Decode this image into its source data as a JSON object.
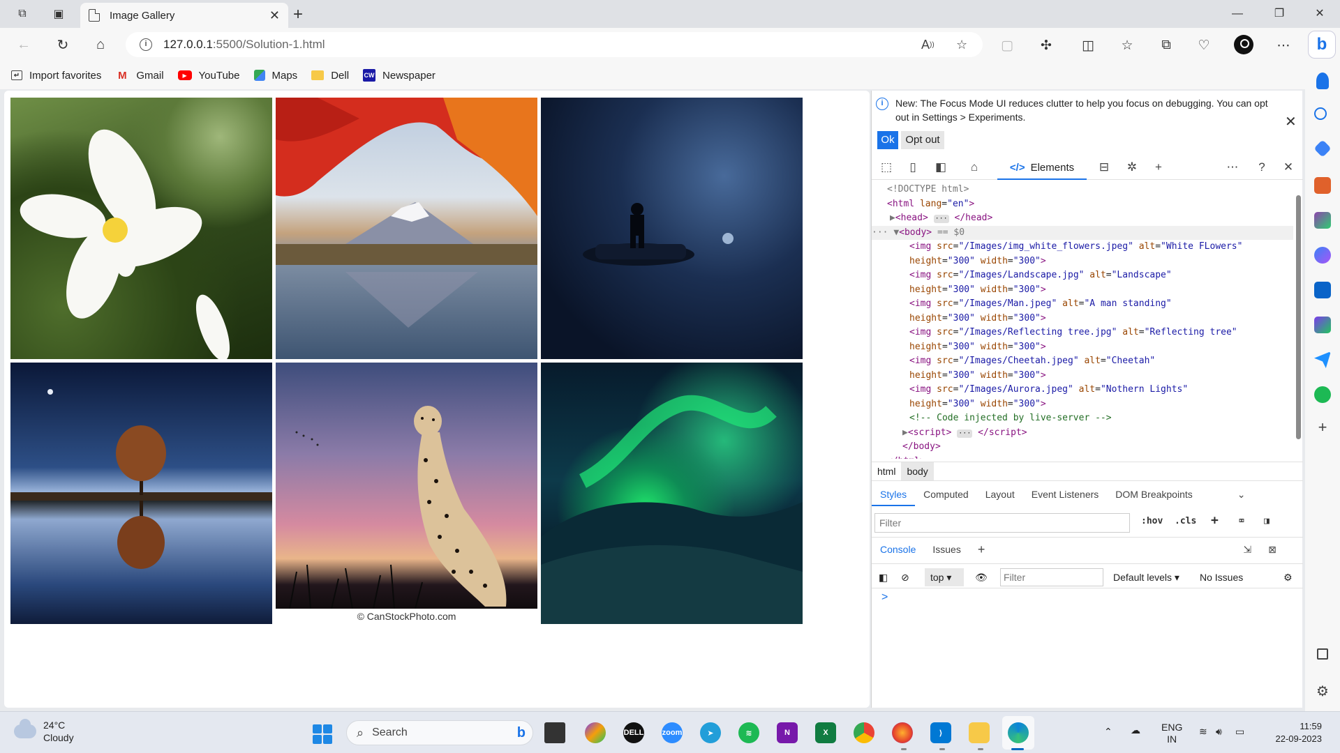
{
  "browser": {
    "tab_title": "Image Gallery",
    "url_host": "127.0.0.1",
    "url_rest": ":5500/Solution-1.html",
    "favorites": [
      {
        "label": "Import favorites",
        "icon": "import-icon"
      },
      {
        "label": "Gmail",
        "icon": "gmail-icon"
      },
      {
        "label": "YouTube",
        "icon": "youtube-icon"
      },
      {
        "label": "Maps",
        "icon": "maps-icon"
      },
      {
        "label": "Dell",
        "icon": "folder-icon"
      },
      {
        "label": "Newspaper",
        "icon": "cw-icon"
      }
    ]
  },
  "gallery": {
    "images": [
      {
        "alt": "White FLowers"
      },
      {
        "alt": "Landscape"
      },
      {
        "alt": "A man standing"
      },
      {
        "alt": "Reflecting tree"
      },
      {
        "alt": "Cheetah",
        "caption": "© CanStockPhoto.com"
      },
      {
        "alt": "Nothern Lights"
      }
    ]
  },
  "devtools": {
    "info_message": "New: The Focus Mode UI reduces clutter to help you focus on debugging. You can opt out in Settings > Experiments.",
    "ok_label": "Ok",
    "opt_out_label": "Opt out",
    "elements_tab": "Elements",
    "dom": {
      "doctype": "<!DOCTYPE html>",
      "html_lang": "en",
      "body_marker": "== $0",
      "imgs": [
        {
          "src": "/Images/img_white_flowers.jpeg",
          "alt": "White FLowers",
          "height": "300",
          "width": "300"
        },
        {
          "src": "/Images/Landscape.jpg",
          "alt": "Landscape",
          "height": "300",
          "width": "300"
        },
        {
          "src": "/Images/Man.jpeg",
          "alt": "A man standing",
          "height": "300",
          "width": "300"
        },
        {
          "src": "/Images/Reflecting tree.jpg",
          "alt": "Reflecting tree",
          "height": "300",
          "width": "300"
        },
        {
          "src": "/Images/Cheetah.jpeg",
          "alt": "Cheetah",
          "height": "300",
          "width": "300"
        },
        {
          "src": "/Images/Aurora.jpeg",
          "alt": "Nothern Lights",
          "height": "300",
          "width": "300"
        }
      ],
      "comment": "<!-- Code injected by live-server -->"
    },
    "breadcrumbs": [
      "html",
      "body"
    ],
    "style_tabs": [
      "Styles",
      "Computed",
      "Layout",
      "Event Listeners",
      "DOM Breakpoints"
    ],
    "styles_filter_placeholder": "Filter",
    "hov_label": ":hov",
    "cls_label": ".cls",
    "console_tabs": [
      "Console",
      "Issues"
    ],
    "console": {
      "context": "top",
      "filter_placeholder": "Filter",
      "levels": "Default levels",
      "issues": "No Issues",
      "prompt": ">"
    }
  },
  "taskbar": {
    "temperature": "24°C",
    "condition": "Cloudy",
    "search_label": "Search",
    "lang_top": "ENG",
    "lang_bottom": "IN",
    "time": "11:59",
    "date": "22-09-2023"
  }
}
